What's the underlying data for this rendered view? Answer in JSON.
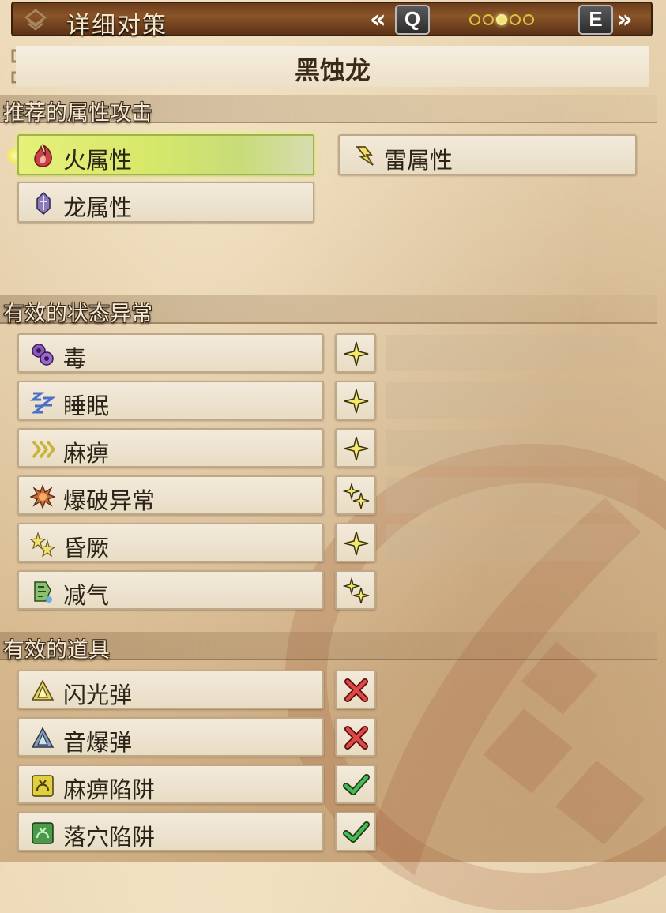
{
  "header": {
    "title": "详细对策",
    "prev_key": "Q",
    "next_key": "E",
    "prev_chevron": "«",
    "next_chevron": "»",
    "page_dots": 5,
    "active_dot": 3
  },
  "monster": {
    "name": "黑蚀龙"
  },
  "sections": {
    "elements": "推荐的属性攻击",
    "ailments": "有效的状态异常",
    "items": "有效的道具"
  },
  "elements": [
    {
      "label": "火属性",
      "icon": "fire-element-icon",
      "selected": true
    },
    {
      "label": "雷属性",
      "icon": "thunder-element-icon",
      "selected": false
    },
    {
      "label": "龙属性",
      "icon": "dragon-element-icon",
      "selected": false
    }
  ],
  "ailments": [
    {
      "label": "毒",
      "icon": "poison-icon",
      "effectiveness": "single-star"
    },
    {
      "label": "睡眠",
      "icon": "sleep-icon",
      "effectiveness": "single-star"
    },
    {
      "label": "麻痹",
      "icon": "paralysis-icon",
      "effectiveness": "single-star"
    },
    {
      "label": "爆破异常",
      "icon": "blast-icon",
      "effectiveness": "double-star"
    },
    {
      "label": "昏厥",
      "icon": "stun-icon",
      "effectiveness": "single-star"
    },
    {
      "label": "减气",
      "icon": "exhaust-icon",
      "effectiveness": "double-star"
    }
  ],
  "items": [
    {
      "label": "闪光弹",
      "icon": "flash-pod-icon",
      "effective": false
    },
    {
      "label": "音爆弹",
      "icon": "screamer-pod-icon",
      "effective": false
    },
    {
      "label": "麻痹陷阱",
      "icon": "shock-trap-icon",
      "effective": true
    },
    {
      "label": "落穴陷阱",
      "icon": "pitfall-trap-icon",
      "effective": true
    }
  ],
  "colors": {
    "header_bg": "#7a4822",
    "selected_glow": "#e6f07a",
    "star_yellow": "#f4ea6a",
    "cross_red": "#e04848",
    "check_green": "#4ab858"
  }
}
